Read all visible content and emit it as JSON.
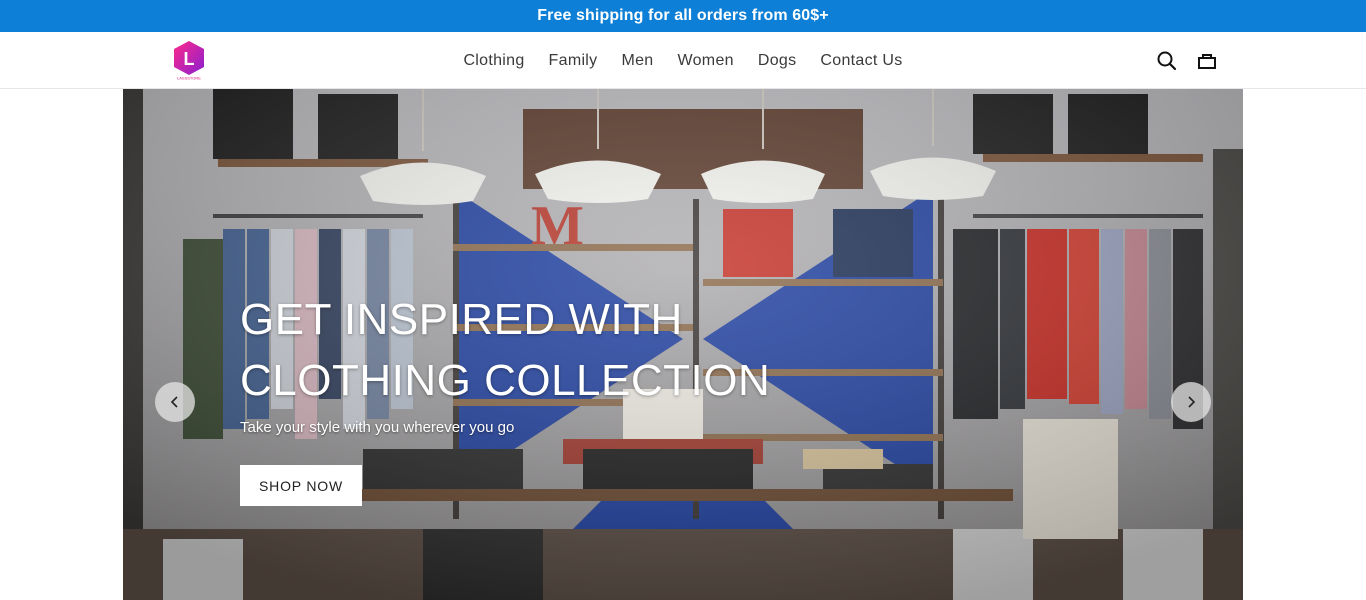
{
  "announcement": "Free shipping for all orders from 60$+",
  "logo": {
    "letter": "L",
    "wordmark": "LASSSTORE",
    "color": "#e0197d"
  },
  "nav": [
    "Clothing",
    "Family",
    "Men",
    "Women",
    "Dogs",
    "Contact Us"
  ],
  "header_icons": [
    "search-icon",
    "cart-icon"
  ],
  "hero": {
    "title_line1": "GET INSPIRED WITH",
    "title_line2": "CLOTHING COLLECTION",
    "subtitle": "Take your style with you wherever you go",
    "button": "SHOP NOW",
    "prev_icon": "chevron-left-icon",
    "next_icon": "chevron-right-icon"
  },
  "colors": {
    "announce_bg": "#0d7fd6",
    "accent": "#e0197d"
  }
}
